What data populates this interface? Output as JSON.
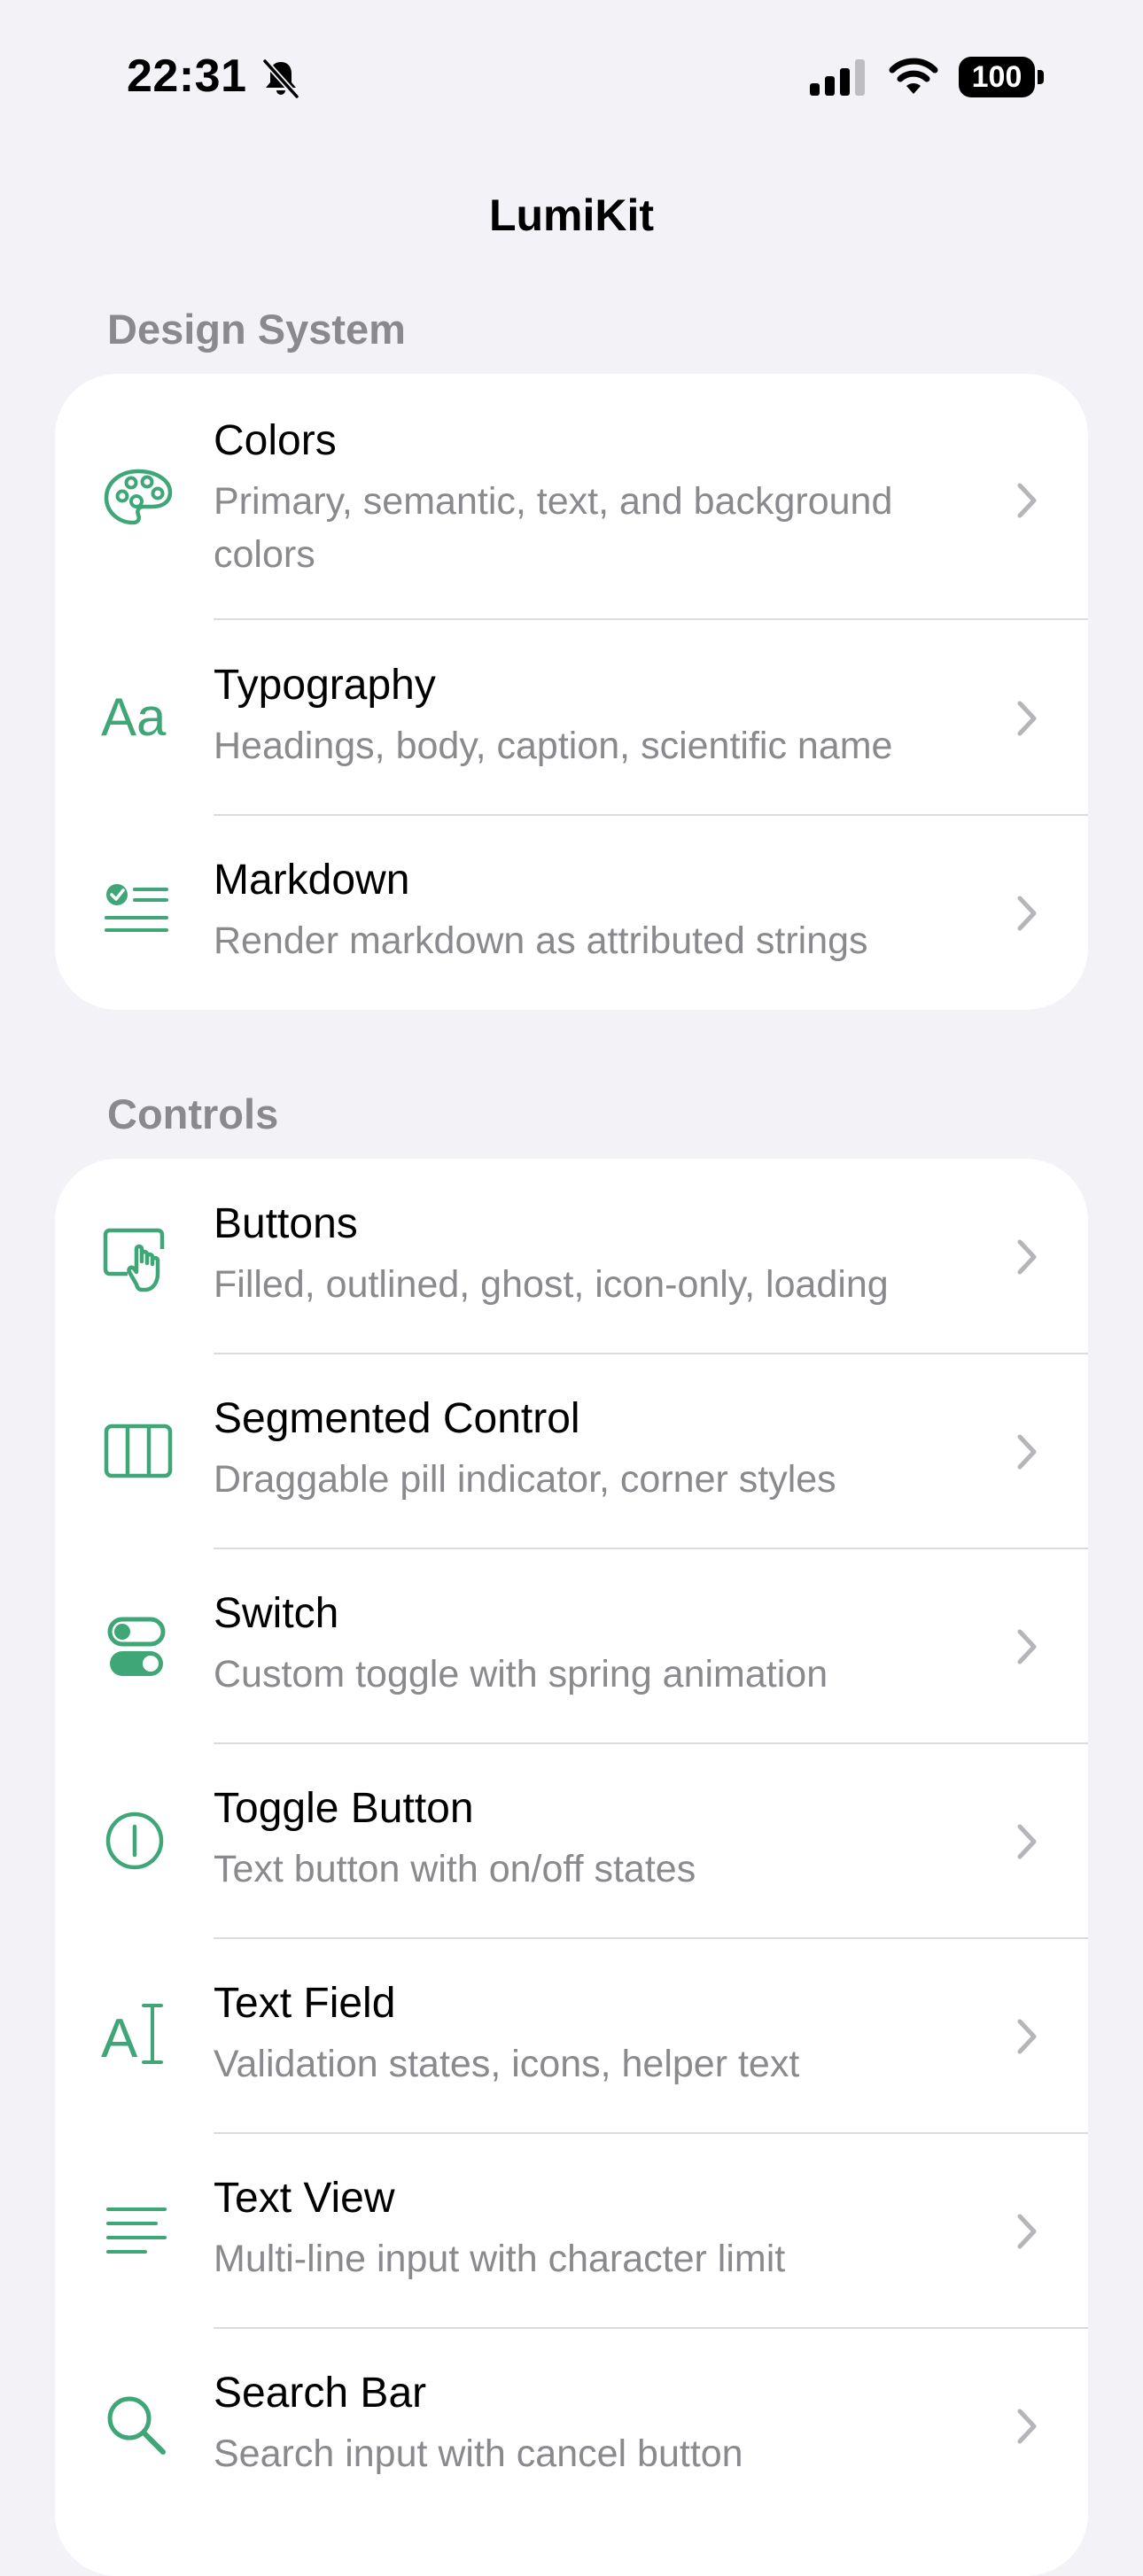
{
  "status": {
    "time": "22:31",
    "battery": "100",
    "icons": [
      "bell-slash-icon",
      "cellular-signal-icon",
      "wifi-icon",
      "battery-icon"
    ]
  },
  "nav": {
    "title": "LumiKit"
  },
  "colors": {
    "accent": "#3fa677",
    "background": "#f2f2f7",
    "secondary_text": "#8a8a8e"
  },
  "sections": {
    "design_system": {
      "header": "Design System",
      "items": [
        {
          "title": "Colors",
          "subtitle": "Primary, semantic, text, and background colors",
          "icon": "palette-icon"
        },
        {
          "title": "Typography",
          "subtitle": "Headings, body, caption, scientific name",
          "icon": "textformat-icon"
        },
        {
          "title": "Markdown",
          "subtitle": "Render markdown as attributed strings",
          "icon": "checklist-icon"
        }
      ]
    },
    "controls": {
      "header": "Controls",
      "items": [
        {
          "title": "Buttons",
          "subtitle": "Filled, outlined, ghost, icon-only, loading",
          "icon": "hand-tap-icon"
        },
        {
          "title": "Segmented Control",
          "subtitle": "Draggable pill indicator, corner styles",
          "icon": "segmented-columns-icon"
        },
        {
          "title": "Switch",
          "subtitle": "Custom toggle with spring animation",
          "icon": "switch-toggles-icon"
        },
        {
          "title": "Toggle Button",
          "subtitle": "Text button with on/off states",
          "icon": "power-circle-icon"
        },
        {
          "title": "Text Field",
          "subtitle": "Validation states, icons, helper text",
          "icon": "text-cursor-icon"
        },
        {
          "title": "Text View",
          "subtitle": "Multi-line input with character limit",
          "icon": "text-lines-icon"
        },
        {
          "title": "Search Bar",
          "subtitle": "Search input with cancel button",
          "icon": "magnifying-glass-icon"
        }
      ]
    }
  }
}
